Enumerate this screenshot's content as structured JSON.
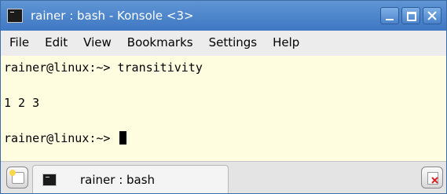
{
  "window": {
    "title": "rainer : bash - Konsole <3>",
    "icon": "terminal-icon"
  },
  "menubar": {
    "items": [
      "File",
      "Edit",
      "View",
      "Bookmarks",
      "Settings",
      "Help"
    ]
  },
  "terminal": {
    "lines": [
      "rainer@linux:~> transitivity",
      "",
      "1 2 3",
      "",
      "rainer@linux:~> "
    ],
    "background": "#fffde0"
  },
  "tabs": {
    "active_label": "rainer : bash",
    "new_tab_icon": "new-tab-icon",
    "close_tab_icon": "close-tab-icon"
  },
  "colors": {
    "titlebar": "#4a82c9",
    "close_x": "#d22"
  }
}
